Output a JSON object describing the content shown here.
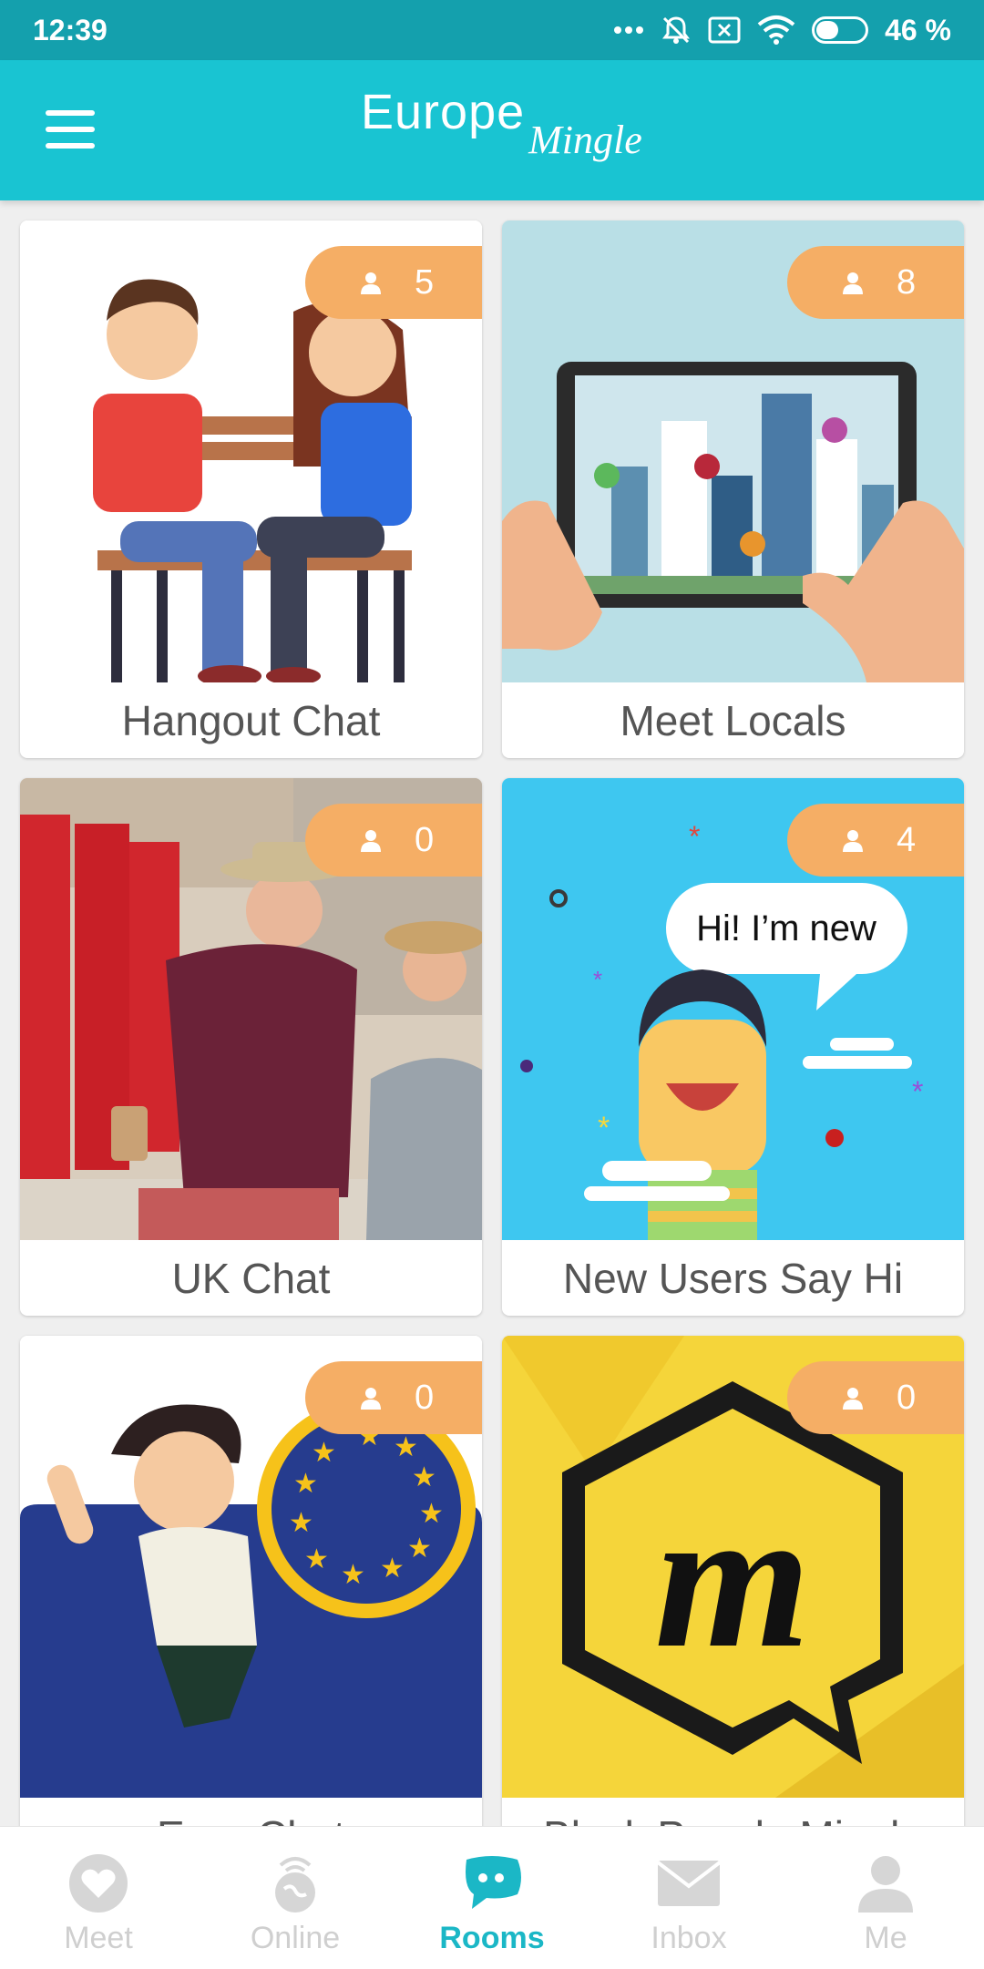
{
  "status_bar": {
    "time": "12:39",
    "battery": "46 %",
    "battery_level": 0.46,
    "icons": [
      "more-dots-icon",
      "bell-muted-icon",
      "sim-x-icon",
      "wifi-icon",
      "battery-icon"
    ]
  },
  "header": {
    "logo_main": "Europe",
    "logo_sub": "Mingle",
    "menu_icon": "hamburger-menu-icon"
  },
  "rooms": [
    {
      "name": "Hangout Chat",
      "members": "5"
    },
    {
      "name": "Meet Locals",
      "members": "8"
    },
    {
      "name": "UK Chat",
      "members": "0"
    },
    {
      "name": "New Users Say Hi",
      "members": "4",
      "image_text": "Hi! I’m new"
    },
    {
      "name": "Euro Chat",
      "members": "0"
    },
    {
      "name": "Black People Mingle",
      "members": "0"
    }
  ],
  "bottom_nav": [
    {
      "label": "Meet",
      "icon": "heart-icon",
      "active": false
    },
    {
      "label": "Online",
      "icon": "globe-icon",
      "active": false
    },
    {
      "label": "Rooms",
      "icon": "chat-bubble-icon",
      "active": true
    },
    {
      "label": "Inbox",
      "icon": "envelope-icon",
      "active": false
    },
    {
      "label": "Me",
      "icon": "user-icon",
      "active": false
    }
  ],
  "colors": {
    "status_bar": "#14a0ad",
    "header": "#19c4d2",
    "badge": "#f5ae65",
    "active_nav": "#1bb7c6",
    "inactive_nav": "#cfcfcf"
  }
}
